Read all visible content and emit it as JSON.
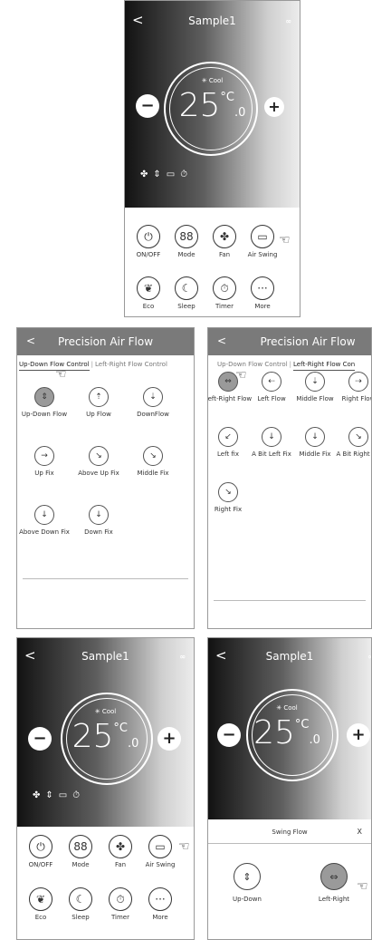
{
  "p1": {
    "back": "<",
    "title": "Sample1",
    "more": "∞",
    "mode_icon": "snowflake-icon",
    "mode": "Cool",
    "temp_int": "25",
    "unit": "°C",
    "temp_dec": ".0",
    "minus": "−",
    "plus": "+",
    "buttons": [
      {
        "icon": "power-icon",
        "glyph": "⏻",
        "label": "ON/OFF"
      },
      {
        "icon": "mode-grid-icon",
        "glyph": "88",
        "label": "Mode"
      },
      {
        "icon": "fan-icon",
        "glyph": "✤",
        "label": "Fan"
      },
      {
        "icon": "swing-icon",
        "glyph": "▭",
        "label": "Air Swing"
      },
      {
        "icon": "leaf-icon",
        "glyph": "❦",
        "label": "Eco"
      },
      {
        "icon": "moon-icon",
        "glyph": "☾",
        "label": "Sleep"
      },
      {
        "icon": "timer-icon",
        "glyph": "⏱",
        "label": "Timer"
      },
      {
        "icon": "more-dots-icon",
        "glyph": "···",
        "label": "More"
      }
    ]
  },
  "p2": {
    "back": "<",
    "title": "Precision Air Flow",
    "tab_active": "Up-Down Flow Control",
    "tab_other": "Left-Right Flow Control",
    "items": [
      {
        "label": "Up-Down Flow",
        "icon": "updown-flow-icon",
        "glyph": "⇕",
        "selected": true
      },
      {
        "label": "Up Flow",
        "icon": "up-flow-icon",
        "glyph": "⇡"
      },
      {
        "label": "DownFlow",
        "icon": "down-flow-icon",
        "glyph": "⇣"
      },
      {
        "label": "Up Fix",
        "icon": "up-fix-icon",
        "glyph": "→"
      },
      {
        "label": "Above Up Fix",
        "icon": "above-up-fix-icon",
        "glyph": "↘"
      },
      {
        "label": "Middle Fix",
        "icon": "middle-fix-icon",
        "glyph": "↘"
      },
      {
        "label": "Above Down Fix",
        "icon": "above-down-fix-icon",
        "glyph": "↓"
      },
      {
        "label": "Down Fix",
        "icon": "down-fix-icon",
        "glyph": "↓"
      }
    ]
  },
  "p3": {
    "back": "<",
    "title": "Precision Air Flow",
    "tab_active": "Up-Down Flow Control",
    "tab_other": "Left-Right Flow Con",
    "items": [
      {
        "label": "Left-Right Flow",
        "icon": "leftright-flow-icon",
        "glyph": "⇔",
        "selected": true
      },
      {
        "label": "Left Flow",
        "icon": "left-flow-icon",
        "glyph": "⇠"
      },
      {
        "label": "Middle Flow",
        "icon": "middle-flow-icon",
        "glyph": "⇣"
      },
      {
        "label": "Right Flow",
        "icon": "right-flow-icon",
        "glyph": "⇢"
      },
      {
        "label": "Left fix",
        "icon": "left-fix-icon",
        "glyph": "↙"
      },
      {
        "label": "A Bit Left Fix",
        "icon": "bit-left-fix-icon",
        "glyph": "↓"
      },
      {
        "label": "Middle Fix",
        "icon": "middle-fix-lr-icon",
        "glyph": "↓"
      },
      {
        "label": "A Bit Right Fix",
        "icon": "bit-right-fix-icon",
        "glyph": "↘"
      },
      {
        "label": "Right Fix",
        "icon": "right-fix-icon",
        "glyph": "↘"
      }
    ]
  },
  "p4": {
    "back": "<",
    "title": "Sample1",
    "more": "∞",
    "mode": "Cool",
    "temp_int": "25",
    "unit": "°C",
    "temp_dec": ".0",
    "minus": "−",
    "plus": "+",
    "buttons": [
      {
        "icon": "power-icon",
        "glyph": "⏻",
        "label": "ON/OFF"
      },
      {
        "icon": "mode-grid-icon",
        "glyph": "88",
        "label": "Mode"
      },
      {
        "icon": "fan-icon",
        "glyph": "✤",
        "label": "Fan"
      },
      {
        "icon": "swing-icon",
        "glyph": "▭",
        "label": "Air Swing"
      },
      {
        "icon": "leaf-icon",
        "glyph": "❦",
        "label": "Eco"
      },
      {
        "icon": "moon-icon",
        "glyph": "☾",
        "label": "Sleep"
      },
      {
        "icon": "timer-icon",
        "glyph": "⏱",
        "label": "Timer"
      },
      {
        "icon": "more-dots-icon",
        "glyph": "···",
        "label": "More"
      }
    ]
  },
  "p5": {
    "back": "<",
    "title": "Sample1",
    "more": "∞",
    "mode": "Cool",
    "temp_int": "25",
    "unit": "°C",
    "temp_dec": ".0",
    "minus": "−",
    "plus": "+",
    "sheet_title": "Swing Flow",
    "close": "X",
    "options": [
      {
        "label": "Up-Down",
        "icon": "updown-flow-icon",
        "glyph": "⇕"
      },
      {
        "label": "Left-Right",
        "icon": "leftright-flow-icon",
        "glyph": "⇔",
        "selected": true
      }
    ]
  },
  "colors": {
    "accent": "#7a7a7a",
    "selected": "#9a9a9a"
  }
}
